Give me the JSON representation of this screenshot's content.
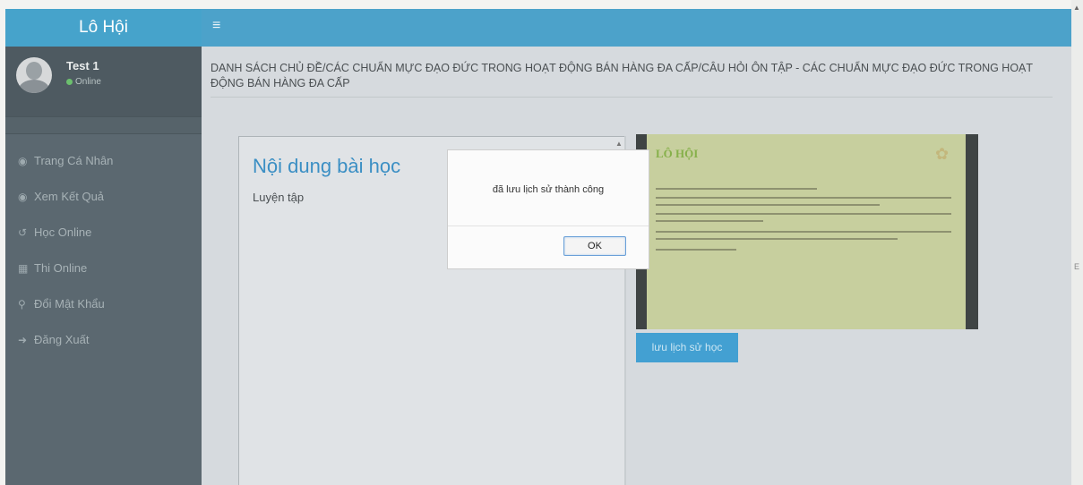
{
  "app": {
    "brand": "Lô Hội",
    "menu_icon": "hamburger-icon"
  },
  "user": {
    "name": "Test 1",
    "status": "Online"
  },
  "sidebar": {
    "items": [
      {
        "label": "Trang Cá Nhân",
        "icon": "user-circle-icon"
      },
      {
        "label": "Xem Kết Quả",
        "icon": "user-circle-icon"
      },
      {
        "label": "Học Online",
        "icon": "history-icon"
      },
      {
        "label": "Thi Online",
        "icon": "calendar-icon"
      },
      {
        "label": "Đổi Mật Khẩu",
        "icon": "key-icon"
      },
      {
        "label": "Đăng Xuất",
        "icon": "sign-out-icon"
      }
    ]
  },
  "main": {
    "heading": "Danh sách chủ đề/CÁC CHUẨN MỰC ĐẠO ĐỨC TRONG HOẠT ĐỘNG BÁN HÀNG ĐA CẤP/CÂU HỎI ÔN TẬP - CÁC CHUẨN MỰC ĐẠO ĐỨC TRONG HOẠT ĐỘNG BÁN HÀNG ĐA CẤP",
    "lesson_title": "Nội dung bài học",
    "lesson_sub": "Luyện tập",
    "slide_logo": "LÔ HỘI",
    "history_button": "lưu lịch sử học"
  },
  "dialog": {
    "message": "đã lưu lịch sử thành công",
    "ok": "OK"
  },
  "colors": {
    "header": "#4ca2ca",
    "sidebar": "#5b6870",
    "accent": "#3b8fc4"
  }
}
